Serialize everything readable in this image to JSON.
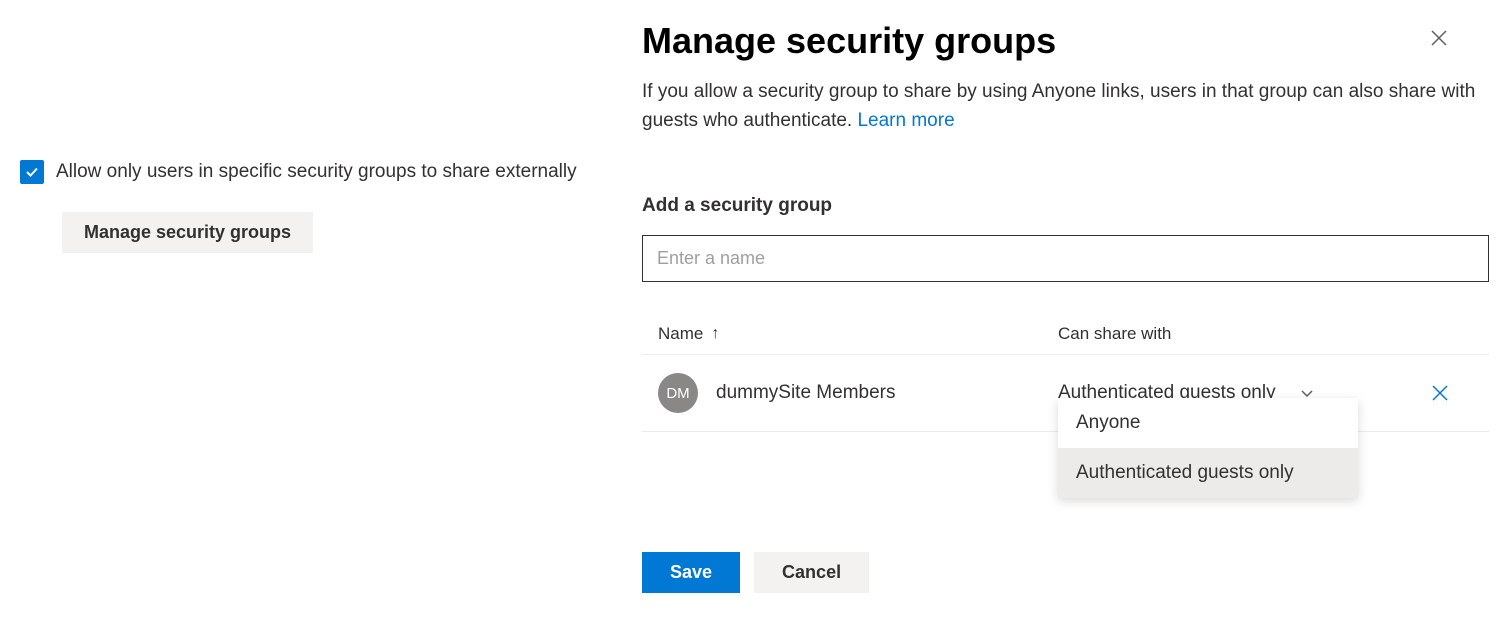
{
  "left": {
    "checkbox_label": "Allow only users in specific security groups to share externally",
    "manage_button": "Manage security groups"
  },
  "panel": {
    "title": "Manage security groups",
    "description": "If you allow a security group to share by using Anyone links, users in that group can also share with guests who authenticate.",
    "learn_more": "Learn more",
    "add_label": "Add a security group",
    "input_placeholder": "Enter a name"
  },
  "table": {
    "headers": {
      "name": "Name",
      "can_share": "Can share with"
    },
    "rows": [
      {
        "initials": "DM",
        "name": "dummySite Members",
        "share_with": "Authenticated guests only"
      }
    ]
  },
  "dropdown": {
    "options": [
      {
        "label": "Anyone",
        "selected": false
      },
      {
        "label": "Authenticated guests only",
        "selected": true
      }
    ]
  },
  "footer": {
    "save": "Save",
    "cancel": "Cancel"
  }
}
